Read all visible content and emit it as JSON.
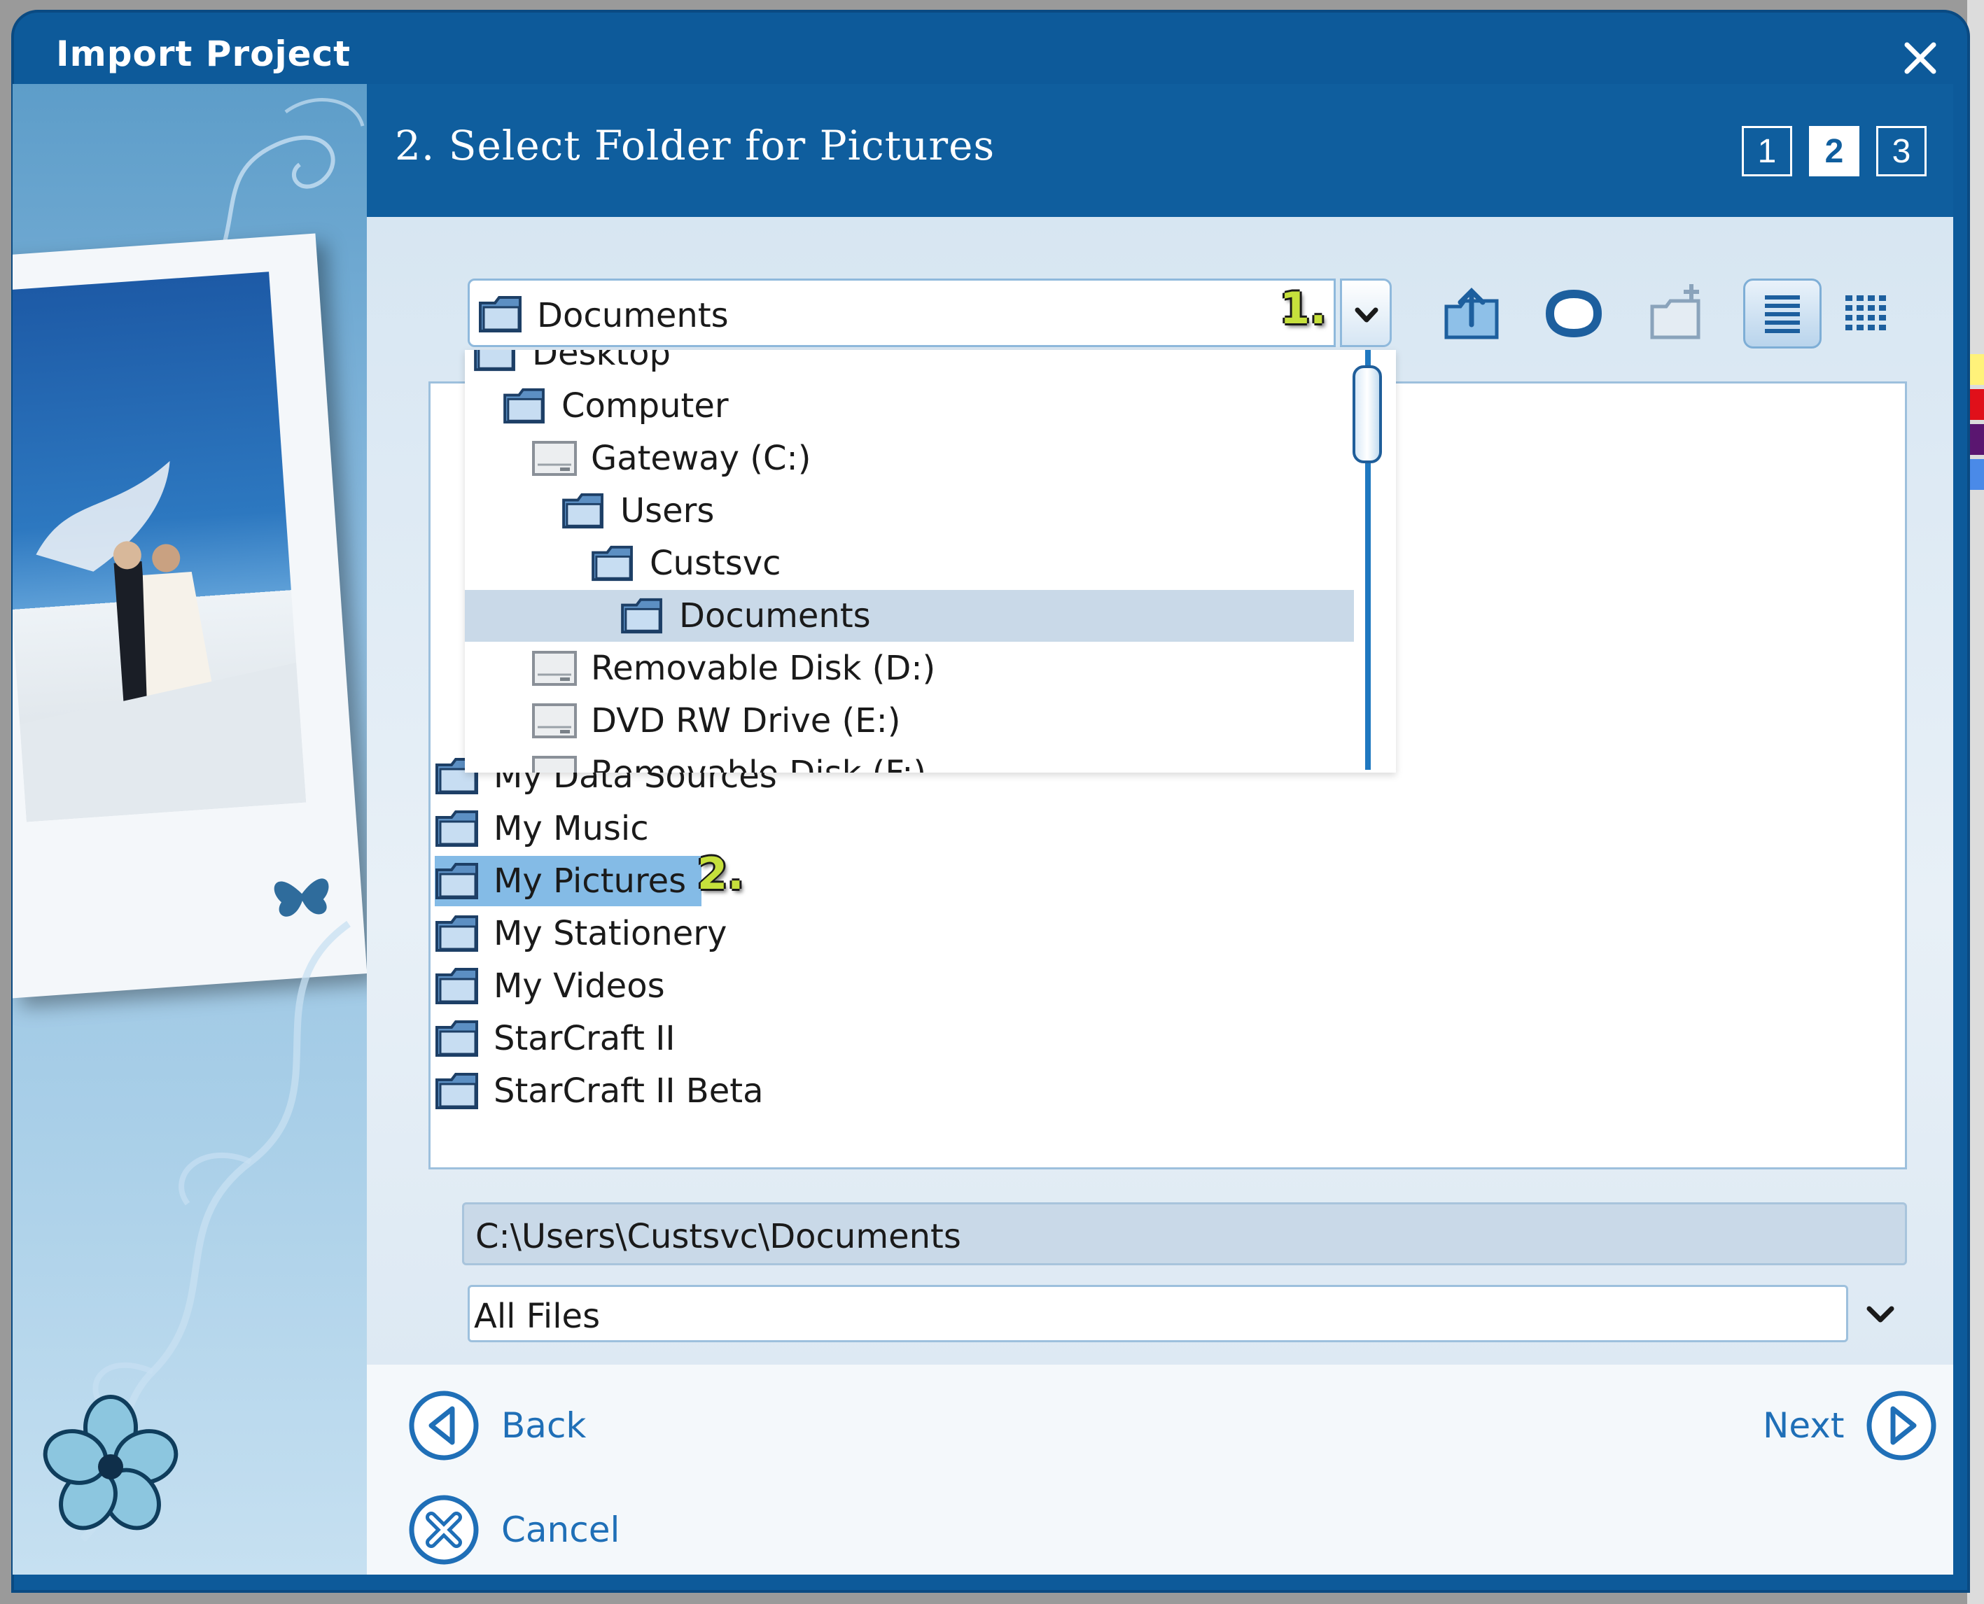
{
  "window": {
    "title": "Import Project"
  },
  "header": {
    "step_title": "2. Select Folder for Pictures",
    "steps": [
      "1",
      "2",
      "3"
    ],
    "active_step": "2"
  },
  "location_combo": {
    "value": "Documents",
    "marker": "1."
  },
  "toolbar": {
    "buttons": [
      {
        "icon": "up-folder-icon"
      },
      {
        "icon": "home-icon"
      },
      {
        "icon": "new-folder-icon"
      },
      {
        "icon": "list-view-icon",
        "pressed": true
      },
      {
        "icon": "details-view-icon"
      }
    ]
  },
  "dropdown": {
    "items": [
      {
        "label": "Desktop",
        "kind": "folder",
        "indent": 0
      },
      {
        "label": "Computer",
        "kind": "folder",
        "indent": 1
      },
      {
        "label": "Gateway (C:)",
        "kind": "drive",
        "indent": 2
      },
      {
        "label": "Users",
        "kind": "folder",
        "indent": 3
      },
      {
        "label": "Custsvc",
        "kind": "folder",
        "indent": 4
      },
      {
        "label": "Documents",
        "kind": "folder",
        "indent": 5,
        "selected": true
      },
      {
        "label": "Removable Disk (D:)",
        "kind": "drive",
        "indent": 2
      },
      {
        "label": "DVD RW Drive (E:)",
        "kind": "drive",
        "indent": 2
      },
      {
        "label": "Removable Disk (F:)",
        "kind": "drive",
        "indent": 2
      }
    ]
  },
  "file_list": {
    "items": [
      {
        "label": "My Data Sources"
      },
      {
        "label": "My Music"
      },
      {
        "label": "My Pictures",
        "selected": true
      },
      {
        "label": "My Stationery"
      },
      {
        "label": "My Videos"
      },
      {
        "label": "StarCraft II"
      },
      {
        "label": "StarCraft II Beta"
      }
    ],
    "marker": "2."
  },
  "path_field": {
    "value": "C:\\Users\\Custsvc\\Documents"
  },
  "filter": {
    "value": "All Files"
  },
  "nav": {
    "back_label": "Back",
    "next_label": "Next",
    "cancel_label": "Cancel"
  },
  "colors": {
    "brand_blue": "#0f5e9e",
    "link_blue": "#1f6fb7",
    "selection": "#84bbe6",
    "marker_green": "#c6e03c"
  }
}
